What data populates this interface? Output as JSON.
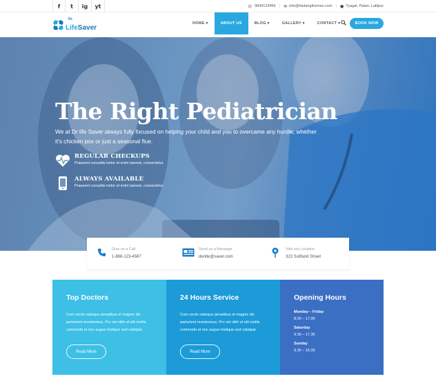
{
  "topbar": {
    "social": [
      "f",
      "t",
      "ig",
      "yt"
    ],
    "phone": "9849123456",
    "email": "info@bizbergthemes.com",
    "location": "Tyagal, Patan, Lalitpur"
  },
  "nav": {
    "logo_dr": "Dr.",
    "logo_life": "Life",
    "logo_saver": "Saver",
    "items": [
      {
        "label": "HOME ▾"
      },
      {
        "label": "ABOUT US"
      },
      {
        "label": "BLOG ▾"
      },
      {
        "label": "GALLERY ▾"
      },
      {
        "label": "CONTACT ▾"
      }
    ],
    "book_label": "BOOK NOW"
  },
  "hero": {
    "title": "The Right Pediatrician",
    "subtitle": "We at Dr life Saver always fully focused on helping your child and you to overcame any hurdle, whether it's chicken pox or just a seasonal flue.",
    "features": [
      {
        "title": "REGULAR CHECKUPS",
        "text": "Praesent convallis tortor et enim laoreet, consectetur."
      },
      {
        "title": "ALWAYS AVAILABLE",
        "text": "Praesent convallis tortor et enim laoreet, consectetur."
      }
    ]
  },
  "contact_strip": [
    {
      "label": "Give us a Call",
      "value": "1-888-123-4567"
    },
    {
      "label": "Send us a Message",
      "value": "dentle@saver.com"
    },
    {
      "label": "Visit our Location",
      "value": "323 Sullfand Street"
    }
  ],
  "cards": [
    {
      "title": "Top Doctors",
      "text": "Cum sociis natoque penatibus et magnis dis parturient montesmus. Pro vel nibh et elit mollis commodo et nec augue tristique sed volutpat.",
      "button": "Read More"
    },
    {
      "title": "24 Hours Service",
      "text": "Cum sociis natoque penatibus et magnis dis parturient montesmus. Pro vel nibh et elit mollis commodo et nec augue tristique sed volutpat.",
      "button": "Read More"
    },
    {
      "title": "Opening Hours",
      "hours": [
        {
          "day": "Monday – Friday",
          "time": "8.00 – 17.00"
        },
        {
          "day": "Saturday",
          "time": "9.30 – 17.30"
        },
        {
          "day": "Sunday",
          "time": "9.30 – 15.00"
        }
      ]
    }
  ],
  "colors": {
    "accent": "#29a8e0",
    "card1": "#3dbfe6",
    "card2": "#1c9bd8",
    "card3": "#3a6fc4"
  }
}
